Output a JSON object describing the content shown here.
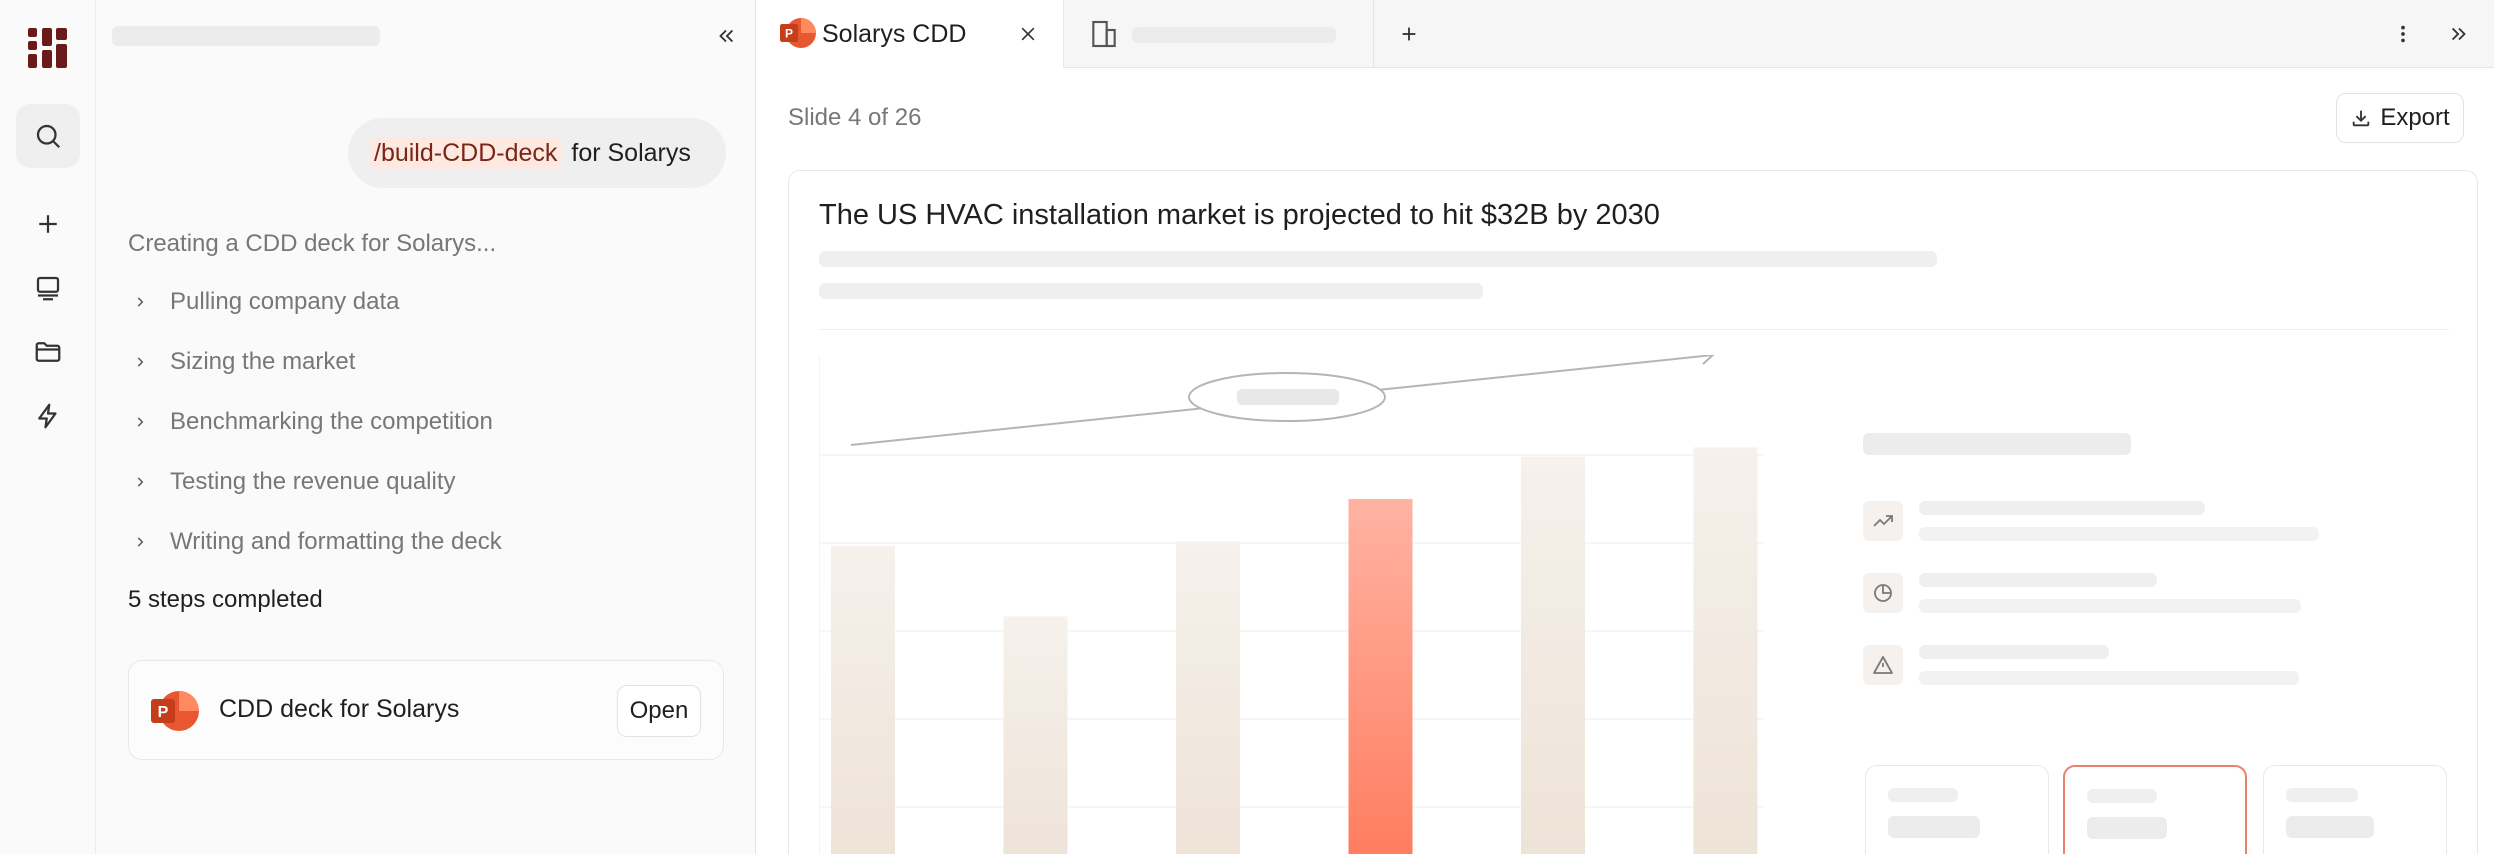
{
  "chat": {
    "user_message": {
      "command": "/build-CDD-deck",
      "text": "for Solarys"
    },
    "status": "Creating a CDD deck for Solarys...",
    "steps": [
      {
        "label": "Pulling company data"
      },
      {
        "label": "Sizing the market"
      },
      {
        "label": "Benchmarking the competition"
      },
      {
        "label": "Testing the revenue quality"
      },
      {
        "label": "Writing and formatting the deck"
      }
    ],
    "steps_summary": "5 steps completed",
    "file_card": {
      "name": "CDD deck for Solarys",
      "open_label": "Open"
    }
  },
  "tabs": {
    "active": {
      "label": "Solarys CDD"
    }
  },
  "viewer": {
    "slide_counter": "Slide 4 of 26",
    "export_label": "Export"
  },
  "slide": {
    "title": "The US HVAC installation market is projected to hit $32B by 2030"
  },
  "chart_data": {
    "type": "bar",
    "categories": [
      "",
      "",
      "",
      "",
      "",
      ""
    ],
    "values": [
      0.7,
      0.55,
      0.71,
      0.8,
      0.89,
      0.91
    ],
    "highlight_index": 3,
    "ylim": [
      0,
      1
    ],
    "grid": true
  },
  "colors": {
    "brand": "#7a1f1f",
    "accent": "#ff7a5c",
    "bar": "#efe6dc"
  },
  "icons": {
    "rail": [
      "search-icon",
      "plus-icon",
      "presentation-icon",
      "folder-icon",
      "lightning-icon"
    ],
    "kpis": [
      "trend-up-icon",
      "pie-chart-icon",
      "warning-icon"
    ]
  }
}
